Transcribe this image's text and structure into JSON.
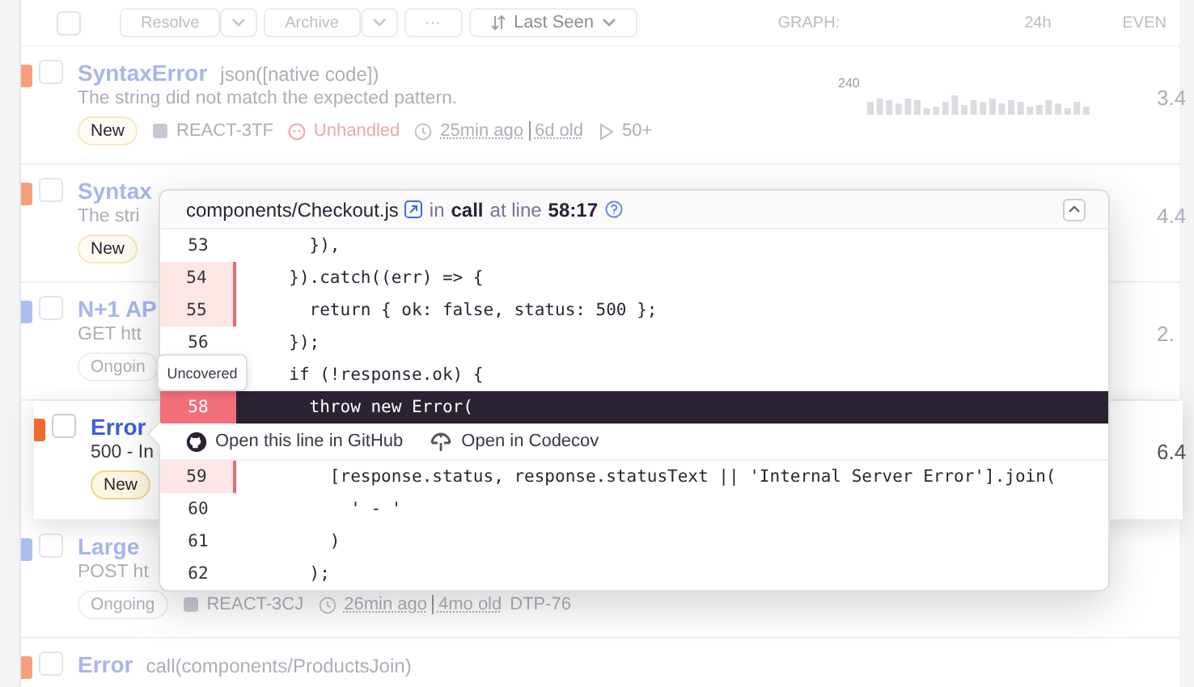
{
  "toolbar": {
    "select_all_checked": false,
    "actions": [
      {
        "label": "Resolve",
        "dropdown": true
      },
      {
        "label": "Archive",
        "dropdown": true
      },
      {
        "label": "···",
        "dropdown": false
      }
    ],
    "sort": "Last Seen",
    "columns": [
      "GRAPH:",
      "24h",
      "EVEN"
    ]
  },
  "issues": [
    {
      "color": "#f5a07a",
      "highlighted": false,
      "checked": false,
      "title": "SyntaxError",
      "subtitle": "json([native code])",
      "description": "The string did not match the expected pattern.",
      "badge": {
        "label": "New",
        "kind": "new"
      },
      "project": "REACT-3TF",
      "unhandled": "Unhandled",
      "time": "25min ago",
      "age": "6d old",
      "replays": "50+",
      "graph_label": "240",
      "count": "3.4"
    },
    {
      "color": "#f5a07a",
      "highlighted": false,
      "checked": false,
      "title": "Syntax",
      "description": "The stri",
      "badge": {
        "label": "New",
        "kind": "new"
      },
      "count": "4.4"
    },
    {
      "color": "#a9bff0",
      "highlighted": false,
      "checked": false,
      "title": "N+1 AP",
      "description": "GET htt",
      "badge": {
        "label": "Ongoin",
        "kind": "ongoing"
      },
      "count": "2."
    },
    {
      "color": "#f26b2e",
      "highlighted": true,
      "checked": false,
      "title": "Error",
      "description": "500 - In",
      "badge": {
        "label": "New",
        "kind": "new"
      },
      "count": "6.4"
    },
    {
      "color": "#a9bff0",
      "highlighted": false,
      "checked": false,
      "title": "Large",
      "description": "POST ht",
      "badge": {
        "label": "Ongoing",
        "kind": "ongoing"
      },
      "project": "REACT-3CJ",
      "time": "26min ago",
      "age": "4mo old",
      "ticket": "DTP-76"
    },
    {
      "color": "#f5a07a",
      "highlighted": false,
      "checked": false,
      "title": "Error",
      "subtitle": "call(components/ProductsJoin)"
    }
  ],
  "code_popup": {
    "file": "components/Checkout.js",
    "in_word": "in",
    "function": "call",
    "at_word": "at line",
    "position": "58:17",
    "tooltip": "Uncovered",
    "lines": [
      {
        "number": "53",
        "code": "    }),",
        "uncovered": false,
        "selected": false
      },
      {
        "number": "54",
        "code": "  }).catch((err) => {",
        "uncovered": true,
        "selected": false
      },
      {
        "number": "55",
        "code": "    return { ok: false, status: 500 };",
        "uncovered": true,
        "selected": false
      },
      {
        "number": "56",
        "code": "  });",
        "uncovered": false,
        "selected": false
      },
      {
        "code": "  if (!response.ok) {",
        "selected": false
      },
      {
        "number": "58",
        "code": "    throw new Error(",
        "uncovered": true,
        "selected": true
      },
      {
        "number": "59",
        "code": "      [response.status, response.statusText || 'Internal Server Error'].join(",
        "uncovered": true,
        "selected": false
      },
      {
        "number": "60",
        "code": "        ' - '",
        "uncovered": false,
        "selected": false
      },
      {
        "number": "61",
        "code": "      )",
        "uncovered": false,
        "selected": false
      },
      {
        "number": "62",
        "code": "    );",
        "uncovered": false,
        "selected": false
      }
    ],
    "links": [
      {
        "label": "Open this line in GitHub",
        "kind": "github"
      },
      {
        "label": "Open in Codecov",
        "kind": "codecov"
      }
    ]
  }
}
